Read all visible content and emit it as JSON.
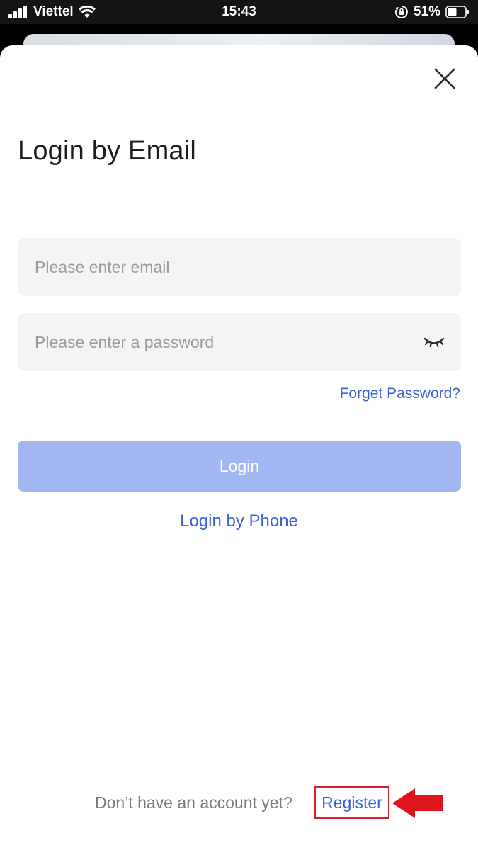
{
  "status_bar": {
    "carrier": "Viettel",
    "time": "15:43",
    "battery": "51%",
    "icons": [
      "signal-icon",
      "wifi-icon",
      "rotation-lock-icon",
      "battery-icon"
    ]
  },
  "modal": {
    "title": "Login by Email",
    "close_icon": "close-icon",
    "email": {
      "value": "",
      "placeholder": "Please enter email"
    },
    "password": {
      "value": "",
      "placeholder": "Please enter a password",
      "toggle_icon": "eye-closed-icon"
    },
    "forget_password": "Forget Password?",
    "login_button": "Login",
    "login_by_phone": "Login by Phone",
    "footer": {
      "prompt": "Don’t have an account yet?",
      "register": "Register"
    }
  },
  "annotation": {
    "arrow_icon": "red-arrow-left-icon",
    "color": "#e0141e"
  },
  "colors": {
    "link": "#3b63d6",
    "button_disabled": "#a2b6f2",
    "field_bg": "#f4f4f5",
    "title": "#1c1c1e"
  }
}
